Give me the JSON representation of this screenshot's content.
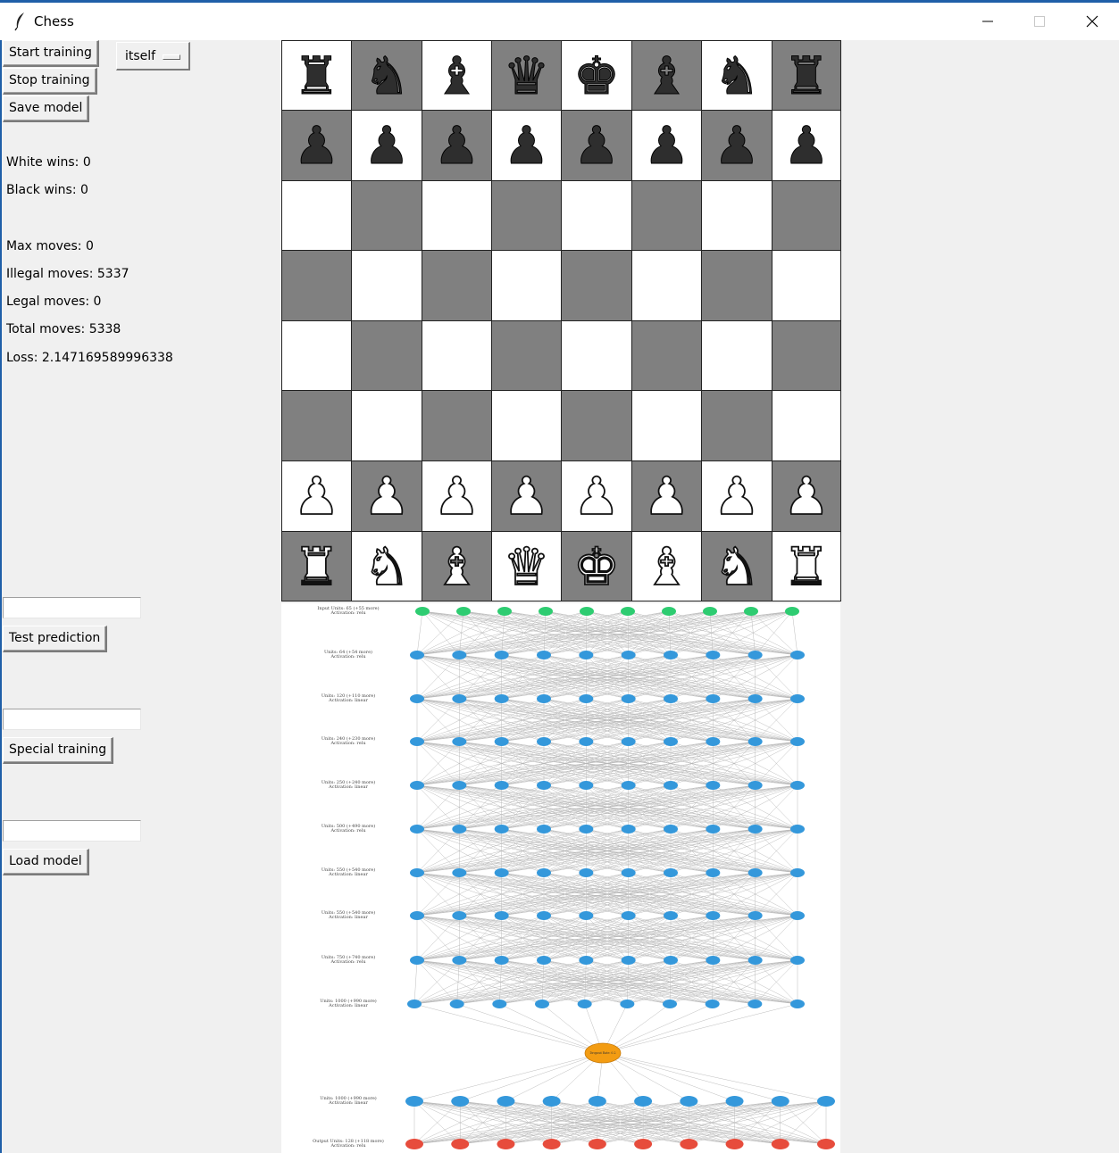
{
  "window": {
    "title": "Chess",
    "accent": "#1f5fa8",
    "icon": "feather-icon"
  },
  "controls": {
    "start_training": "Start training",
    "stop_training": "Stop training",
    "save_model": "Save model",
    "opponent_selected": "itself",
    "test_prediction": "Test prediction",
    "special_training": "Special training",
    "load_model": "Load model",
    "test_input_value": "",
    "special_input_value": "",
    "load_input_value": ""
  },
  "stats": {
    "white_wins": "White wins: 0",
    "black_wins": "Black wins: 0",
    "max_moves": "Max moves: 0",
    "illegal_moves": "Illegal moves: 5337",
    "legal_moves": "Legal moves: 0",
    "total_moves": "Total moves: 5338",
    "loss": "Loss: 2.147169589996338"
  },
  "board": {
    "light_color": "#ffffff",
    "dark_color": "#808080",
    "ranks": [
      [
        "br",
        "bn",
        "bb",
        "bq",
        "bk",
        "bb",
        "bn",
        "br"
      ],
      [
        "bp",
        "bp",
        "bp",
        "bp",
        "bp",
        "bp",
        "bp",
        "bp"
      ],
      [
        "",
        "",
        "",
        "",
        "",
        "",
        "",
        ""
      ],
      [
        "",
        "",
        "",
        "",
        "",
        "",
        "",
        ""
      ],
      [
        "",
        "",
        "",
        "",
        "",
        "",
        "",
        ""
      ],
      [
        "",
        "",
        "",
        "",
        "",
        "",
        "",
        ""
      ],
      [
        "wp",
        "wp",
        "wp",
        "wp",
        "wp",
        "wp",
        "wp",
        "wp"
      ],
      [
        "wr",
        "wn",
        "wb",
        "wq",
        "wk",
        "wb",
        "wn",
        "wr"
      ]
    ]
  },
  "network_diagram": {
    "input_color": "#2ecc71",
    "hidden_color": "#3498db",
    "bottleneck_color": "#f39c12",
    "output_color": "#e74c3c",
    "layers": [
      {
        "label": "Input Units: 65 (+55 more)",
        "sublabel": "Activation: relu",
        "kind": "input",
        "nodes": 10
      },
      {
        "label": "Units: 64 (+54 more)",
        "sublabel": "Activation: relu",
        "kind": "hidden",
        "nodes": 10
      },
      {
        "label": "Units: 120 (+110 more)",
        "sublabel": "Activation: linear",
        "kind": "hidden",
        "nodes": 10
      },
      {
        "label": "Units: 240 (+230 more)",
        "sublabel": "Activation: relu",
        "kind": "hidden",
        "nodes": 10
      },
      {
        "label": "Units: 250 (+240 more)",
        "sublabel": "Activation: linear",
        "kind": "hidden",
        "nodes": 10
      },
      {
        "label": "Units: 500 (+490 more)",
        "sublabel": "Activation: relu",
        "kind": "hidden",
        "nodes": 10
      },
      {
        "label": "Units: 550 (+540 more)",
        "sublabel": "Activation: linear",
        "kind": "hidden",
        "nodes": 10
      },
      {
        "label": "Units: 550 (+540 more)",
        "sublabel": "Activation: linear",
        "kind": "hidden",
        "nodes": 10
      },
      {
        "label": "Units: 750 (+740 more)",
        "sublabel": "Activation: relu",
        "kind": "hidden",
        "nodes": 10
      },
      {
        "label": "Units: 1000 (+990 more)",
        "sublabel": "Activation: linear",
        "kind": "hidden",
        "nodes": 10
      },
      {
        "label": "Dropout Rate: 0.2",
        "sublabel": "",
        "kind": "bottleneck",
        "nodes": 1
      },
      {
        "label": "Units: 1000 (+990 more)",
        "sublabel": "Activation: linear",
        "kind": "hidden",
        "nodes": 10
      },
      {
        "label": "Output Units: 128 (+118 more)",
        "sublabel": "Activation: relu",
        "kind": "output",
        "nodes": 10
      }
    ]
  }
}
